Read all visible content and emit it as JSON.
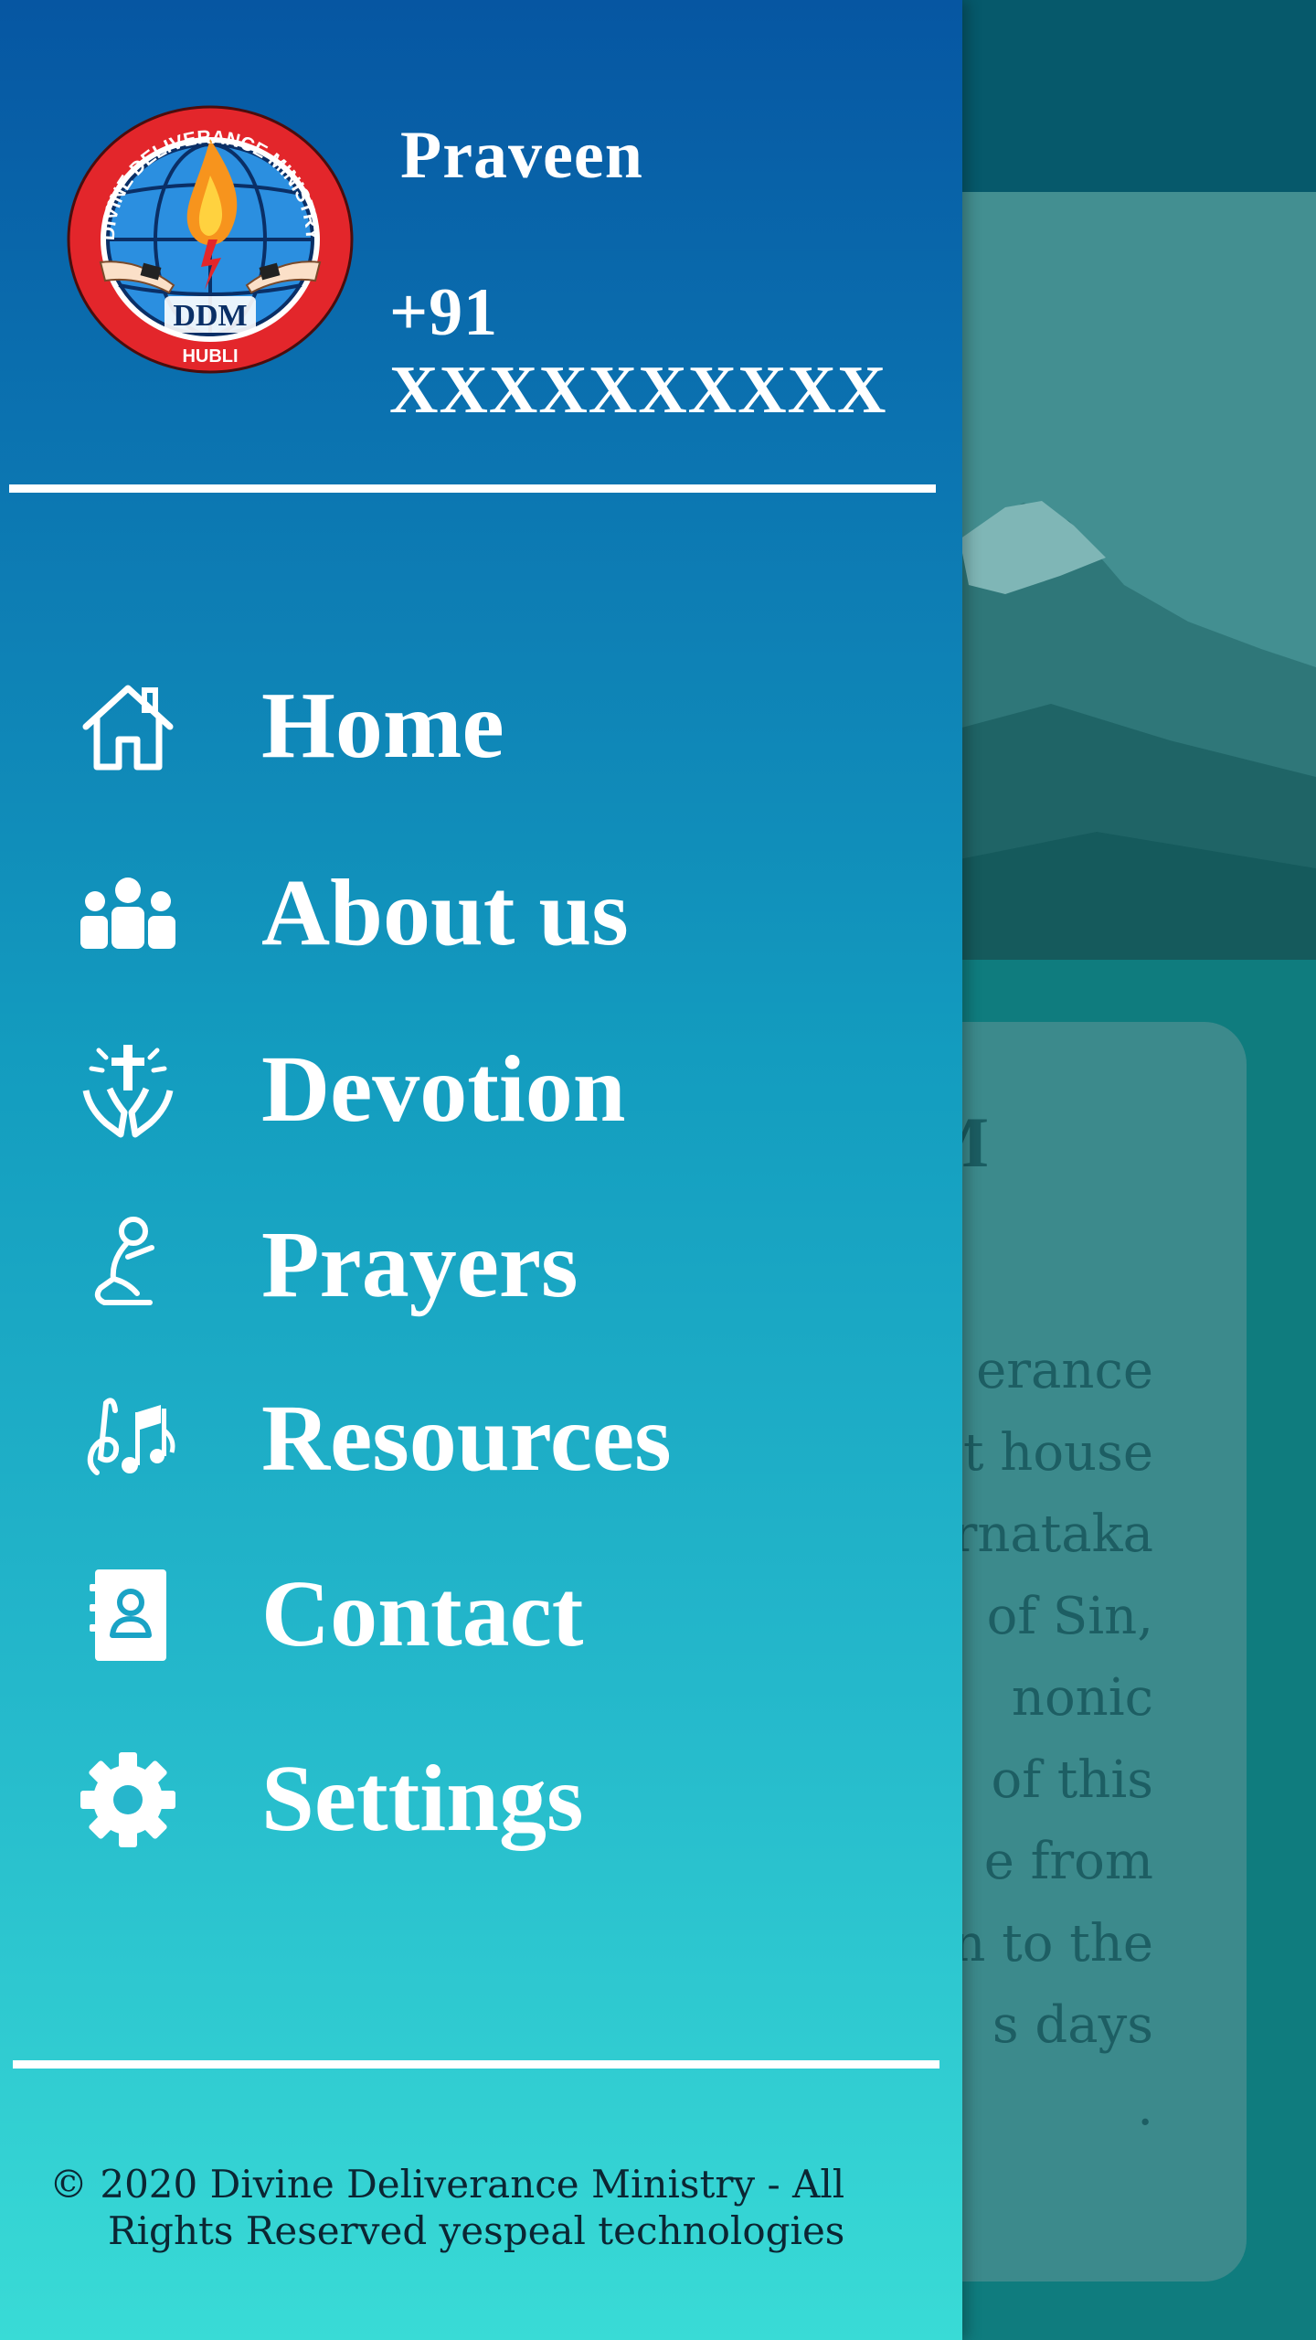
{
  "drawer": {
    "user": {
      "name": "Praveen",
      "phone": "+91 XXXXXXXXXX"
    },
    "logo": {
      "ring_text": "DIVINE DELIVERANCE MINISTRY",
      "center_text": "DDM",
      "bottom_text": "HUBLI"
    },
    "menu": [
      {
        "label": "Home",
        "icon": "home-icon"
      },
      {
        "label": "About us",
        "icon": "people-icon"
      },
      {
        "label": "Devotion",
        "icon": "praying-hands-cross-icon"
      },
      {
        "label": "Prayers",
        "icon": "kneeling-prayer-icon"
      },
      {
        "label": "Resources",
        "icon": "music-notes-icon"
      },
      {
        "label": "Contact",
        "icon": "contact-book-icon"
      },
      {
        "label": "Settings",
        "icon": "gear-icon"
      }
    ],
    "footer": {
      "line1": "© 2020 Divine Deliverance Ministry - All",
      "line2": "Rights Reserved yespeal technologies"
    }
  },
  "background": {
    "card_title_fragment": "DM",
    "card_text_fragments": [
      "erance",
      "t house",
      "rnataka",
      "of Sin,",
      "nonic",
      "of this",
      "e from",
      "n to the",
      "s days",
      "."
    ]
  },
  "colors": {
    "drawer_top": "#0656a2",
    "drawer_bottom": "#39dbd6",
    "text": "#ffffff",
    "footer_text": "#0b2633",
    "logo_red": "#e3262b",
    "logo_blue": "#1d7fd1"
  }
}
